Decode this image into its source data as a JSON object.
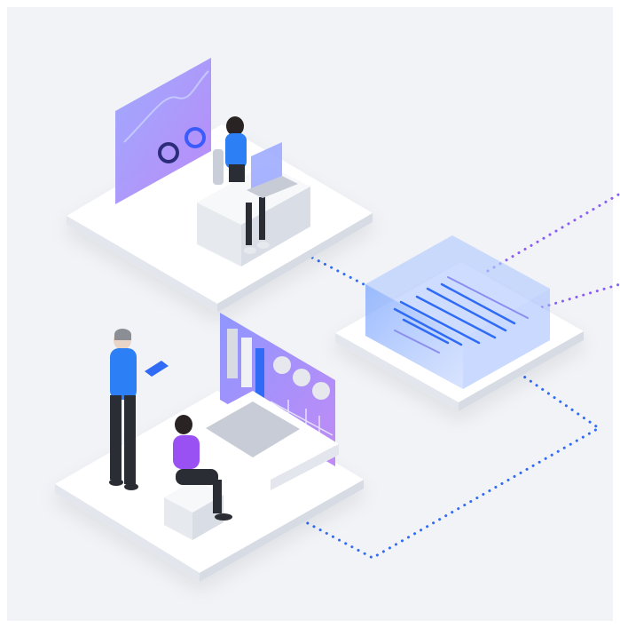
{
  "illustration": {
    "kind": "isometric-workspace-illustration",
    "colors": {
      "background": "#f1f3f7",
      "platform_top": "#ffffff",
      "platform_side": "#e3e6ec",
      "accent_blue": "#2f6bf5",
      "accent_purple": "#8b5cf6",
      "screen_gradient_start": "#9aa7ff",
      "screen_gradient_end": "#b784f7",
      "skin_dark": "#2a2324",
      "hair_grey": "#8b8f95",
      "shirt_blue": "#2d7ff5",
      "shirt_purple": "#9a51f3",
      "pants_dark": "#2a2d33"
    },
    "icons": [
      "analytics-panel-icon",
      "laptop-icon",
      "tablet-icon",
      "dashboard-monitor-icon",
      "data-cube-icon",
      "connection-line-icon"
    ]
  }
}
